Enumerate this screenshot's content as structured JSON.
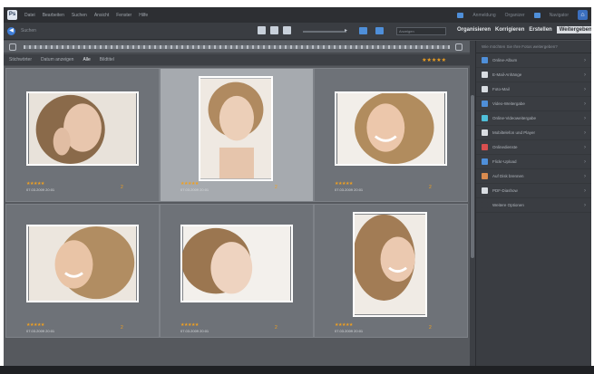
{
  "menubar": {
    "logo": "Ps",
    "items": [
      "Datei",
      "Bearbeiten",
      "Suchen",
      "Ansicht",
      "Fenster",
      "Hilfe"
    ],
    "right": [
      "Anmeldung",
      "Organizer",
      "Navigator"
    ]
  },
  "toolbar": {
    "search_placeholder": "Suchen",
    "dropdown": "Anzeigen",
    "mode_tabs": [
      "Organisieren",
      "Korrigieren",
      "Erstellen",
      "Weitergeben"
    ],
    "active_tab_index": 3
  },
  "filterbar": {
    "items": [
      "Stichwörter",
      "Datum anzeigen",
      "Alle",
      "Bildtitel"
    ],
    "selected_index": 2,
    "stars": "★★★★★"
  },
  "grid": {
    "items": [
      {
        "stars": "★★★★★",
        "meta": "07.03.2009 20:01",
        "badge": "2",
        "selected": false,
        "bg": "#e8e2da"
      },
      {
        "stars": "★★★★★",
        "meta": "07.03.2009 20:01",
        "badge": "2",
        "selected": true,
        "bg": "#efe9e2"
      },
      {
        "stars": "★★★★★",
        "meta": "07.03.2009 20:01",
        "badge": "2",
        "selected": false,
        "bg": "#f2eee9"
      },
      {
        "stars": "★★★★★",
        "meta": "07.03.2009 20:01",
        "badge": "2",
        "selected": false,
        "bg": "#ece6de"
      },
      {
        "stars": "★★★★★",
        "meta": "07.03.2009 20:01",
        "badge": "2",
        "selected": false,
        "bg": "#f3f0ec"
      },
      {
        "stars": "★★★★★",
        "meta": "07.03.2009 20:01",
        "badge": "2",
        "selected": false,
        "bg": "#f0ebe5"
      }
    ]
  },
  "panel": {
    "heading": "Wie möchten Sie Ihre Fotos weitergeben?",
    "items": [
      {
        "label": "Online-Album",
        "icon": "album-icon",
        "color": "#4f8fd9"
      },
      {
        "label": "E-Mail-Anhänge",
        "icon": "mail-icon",
        "color": "#d9dde2"
      },
      {
        "label": "Foto-Mail",
        "icon": "photomail-icon",
        "color": "#d9dde2"
      },
      {
        "label": "Video-Weitergabe",
        "icon": "video-icon",
        "color": "#4f8fd9"
      },
      {
        "label": "Online-Videoweitergabe",
        "icon": "globe-icon",
        "color": "#4fbfd9"
      },
      {
        "label": "Mobiltelefon und Player",
        "icon": "phone-icon",
        "color": "#d9dde2"
      },
      {
        "label": "Onlinedienste",
        "icon": "service-icon",
        "color": "#d94f4f"
      },
      {
        "label": "Flickr-Upload",
        "icon": "flickr-icon",
        "color": "#4f8fd9"
      },
      {
        "label": "Auf Disk brennen",
        "icon": "disc-icon",
        "color": "#d98b4f"
      },
      {
        "label": "PDF-Diashow",
        "icon": "pdf-icon",
        "color": "#d9dde2"
      },
      {
        "label": "Weitere Optionen",
        "icon": "more-icon",
        "color": "#3a3d42"
      }
    ]
  }
}
